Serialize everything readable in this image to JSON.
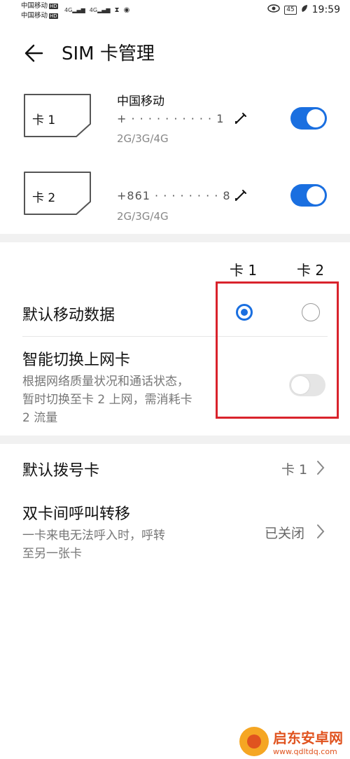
{
  "status_bar": {
    "carrier1": "中国移动",
    "carrier2": "中国移动",
    "hd": "HD",
    "net1": "4G",
    "net2": "4G",
    "battery": "45",
    "time": "19:59"
  },
  "header": {
    "title": "SIM 卡管理"
  },
  "sims": [
    {
      "card_label": "卡 1",
      "carrier": "中国移动",
      "number": "+ · · · · · · · · · · 1",
      "networks": "2G/3G/4G",
      "enabled": true
    },
    {
      "card_label": "卡 2",
      "carrier": "",
      "number": "+861 · · · · · · · · 8",
      "networks": "2G/3G/4G",
      "enabled": true
    }
  ],
  "columns": {
    "card1": "卡 1",
    "card2": "卡 2"
  },
  "default_data": {
    "label": "默认移动数据",
    "selected": "card1"
  },
  "smart_switch": {
    "title": "智能切换上网卡",
    "desc_line1": "根据网络质量状况和通话状态，",
    "desc_line2": "暂时切换至卡 2 上网，需消耗卡",
    "desc_line3": "2 流量",
    "enabled": false
  },
  "default_dial": {
    "label": "默认拨号卡",
    "value": "卡 1"
  },
  "call_forward": {
    "title": "双卡间呼叫转移",
    "desc_line1": "一卡来电无法呼入时，呼转",
    "desc_line2": "至另一张卡",
    "value": "已关闭"
  },
  "watermark": {
    "title": "启东安卓网",
    "url": "www.qdltdq.com"
  },
  "colors": {
    "accent": "#1a6fe0",
    "highlight_box": "#d9232c"
  }
}
